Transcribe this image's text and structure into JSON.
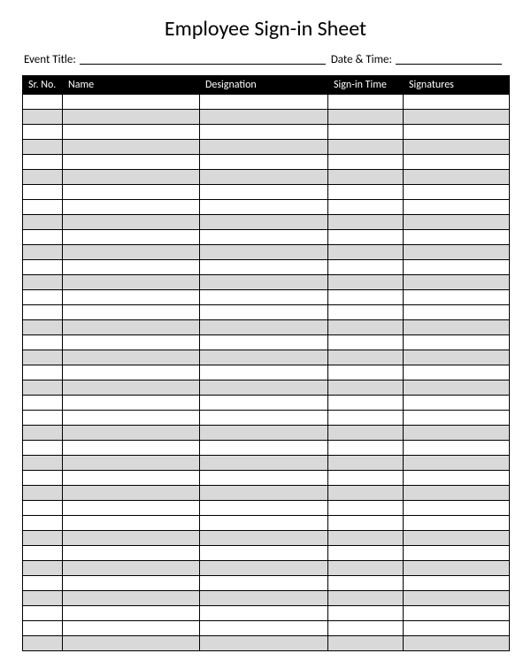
{
  "title": "Employee Sign-in Sheet",
  "meta": {
    "event_label": "Event Title:",
    "datetime_label": "Date & Time:"
  },
  "columns": [
    "Sr. No.",
    "Name",
    "Designation",
    "Sign-in Time",
    "Signatures"
  ],
  "row_count": 37,
  "row_pattern": [
    "white",
    "shaded",
    "white",
    "shaded",
    "white",
    "shaded",
    "white",
    "white",
    "shaded",
    "white",
    "shaded",
    "white",
    "shaded",
    "white",
    "white",
    "shaded",
    "white",
    "shaded",
    "white",
    "shaded",
    "white",
    "white",
    "shaded",
    "white",
    "shaded",
    "white",
    "shaded",
    "white",
    "white",
    "shaded",
    "white",
    "shaded",
    "white",
    "shaded",
    "white",
    "white",
    "shaded"
  ]
}
